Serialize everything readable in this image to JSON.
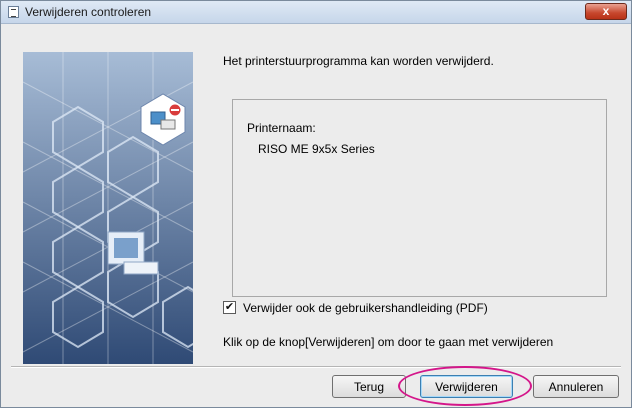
{
  "window": {
    "title": "Verwijderen controleren",
    "close_label": "x"
  },
  "main": {
    "intro_text": "Het printerstuurprogramma kan worden verwijderd.",
    "printer_name_label": "Printernaam:",
    "printer_name_value": "RISO ME 9x5x Series",
    "remove_manual_checkbox": {
      "checked": true,
      "label": "Verwijder ook de gebruikershandleiding (PDF)"
    },
    "hint_text": "Klik op de knop[Verwijderen] om door te gaan met verwijderen"
  },
  "buttons": {
    "back_label": "Terug",
    "remove_label": "Verwijderen",
    "cancel_label": "Annuleren"
  },
  "icons": {
    "title": "app-window-icon",
    "close": "close-icon",
    "art": "printer-illustration"
  },
  "colors": {
    "highlight": "#d4168a",
    "close_button": "#c7472d",
    "art_background": "#5d7aa3"
  }
}
